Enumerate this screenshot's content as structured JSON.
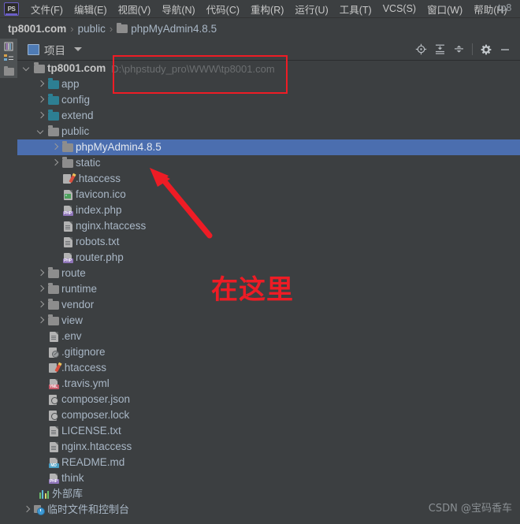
{
  "window": {
    "title_truncated": "tp8",
    "app_icon": "ps-icon"
  },
  "menubar": {
    "items": [
      {
        "label": "文件(F)",
        "name": "menu-file"
      },
      {
        "label": "编辑(E)",
        "name": "menu-edit"
      },
      {
        "label": "视图(V)",
        "name": "menu-view"
      },
      {
        "label": "导航(N)",
        "name": "menu-navigate"
      },
      {
        "label": "代码(C)",
        "name": "menu-code"
      },
      {
        "label": "重构(R)",
        "name": "menu-refactor"
      },
      {
        "label": "运行(U)",
        "name": "menu-run"
      },
      {
        "label": "工具(T)",
        "name": "menu-tools"
      },
      {
        "label": "VCS(S)",
        "name": "menu-vcs"
      },
      {
        "label": "窗口(W)",
        "name": "menu-window"
      },
      {
        "label": "帮助(H)",
        "name": "menu-help"
      }
    ]
  },
  "breadcrumb": {
    "items": [
      "tp8001.com",
      "public",
      "phpMyAdmin4.8.5"
    ],
    "separator": "›"
  },
  "toolwindow": {
    "title": "项目",
    "actions": [
      {
        "name": "locate-file-icon",
        "title": "定位"
      },
      {
        "name": "expand-all-icon",
        "title": "全部展开"
      },
      {
        "name": "collapse-all-icon",
        "title": "全部折叠"
      },
      {
        "name": "settings-gear-icon",
        "title": "设置"
      },
      {
        "name": "hide-minimize-icon",
        "title": "隐藏"
      }
    ]
  },
  "stripe": {
    "tabs": [
      {
        "name": "stripe-tab-project",
        "label": "项目"
      }
    ]
  },
  "tree": {
    "root_hint": "D:\\phpstudy_pro\\WWW\\tp8001.com",
    "rows": [
      {
        "label": "tp8001.com",
        "depth": 0,
        "toggle": "expanded",
        "icon": "folder",
        "style": "bold",
        "hint": true,
        "selected": false
      },
      {
        "label": "app",
        "depth": 1,
        "toggle": "collapsed",
        "icon": "folder-src",
        "selected": false
      },
      {
        "label": "config",
        "depth": 1,
        "toggle": "collapsed",
        "icon": "folder-src",
        "selected": false
      },
      {
        "label": "extend",
        "depth": 1,
        "toggle": "collapsed",
        "icon": "folder-src",
        "selected": false
      },
      {
        "label": "public",
        "depth": 1,
        "toggle": "expanded",
        "icon": "folder",
        "selected": false
      },
      {
        "label": "phpMyAdmin4.8.5",
        "depth": 2,
        "toggle": "collapsed",
        "icon": "folder",
        "selected": true
      },
      {
        "label": "static",
        "depth": 2,
        "toggle": "collapsed",
        "icon": "folder",
        "selected": false
      },
      {
        "label": ".htaccess",
        "depth": 2,
        "toggle": "none",
        "icon": "pencil",
        "selected": false
      },
      {
        "label": "favicon.ico",
        "depth": 2,
        "toggle": "none",
        "icon": "image",
        "selected": false
      },
      {
        "label": "index.php",
        "depth": 2,
        "toggle": "none",
        "icon": "php",
        "selected": false
      },
      {
        "label": "nginx.htaccess",
        "depth": 2,
        "toggle": "none",
        "icon": "doc",
        "selected": false
      },
      {
        "label": "robots.txt",
        "depth": 2,
        "toggle": "none",
        "icon": "doc",
        "selected": false
      },
      {
        "label": "router.php",
        "depth": 2,
        "toggle": "none",
        "icon": "php",
        "selected": false
      },
      {
        "label": "route",
        "depth": 1,
        "toggle": "collapsed",
        "icon": "folder",
        "selected": false
      },
      {
        "label": "runtime",
        "depth": 1,
        "toggle": "collapsed",
        "icon": "folder",
        "selected": false
      },
      {
        "label": "vendor",
        "depth": 1,
        "toggle": "collapsed",
        "icon": "folder",
        "selected": false
      },
      {
        "label": "view",
        "depth": 1,
        "toggle": "collapsed",
        "icon": "folder",
        "selected": false
      },
      {
        "label": ".env",
        "depth": 1,
        "toggle": "none",
        "icon": "doc",
        "selected": false
      },
      {
        "label": ".gitignore",
        "depth": 1,
        "toggle": "none",
        "icon": "git",
        "selected": false
      },
      {
        "label": ".htaccess",
        "depth": 1,
        "toggle": "none",
        "icon": "pencil",
        "selected": false
      },
      {
        "label": ".travis.yml",
        "depth": 1,
        "toggle": "none",
        "icon": "yml",
        "selected": false
      },
      {
        "label": "composer.json",
        "depth": 1,
        "toggle": "none",
        "icon": "json",
        "selected": false
      },
      {
        "label": "composer.lock",
        "depth": 1,
        "toggle": "none",
        "icon": "json",
        "selected": false
      },
      {
        "label": "LICENSE.txt",
        "depth": 1,
        "toggle": "none",
        "icon": "doc",
        "selected": false
      },
      {
        "label": "nginx.htaccess",
        "depth": 1,
        "toggle": "none",
        "icon": "doc",
        "selected": false
      },
      {
        "label": "README.md",
        "depth": 1,
        "toggle": "none",
        "icon": "md",
        "selected": false
      },
      {
        "label": "think",
        "depth": 1,
        "toggle": "none",
        "icon": "php",
        "selected": false
      },
      {
        "label": "外部库",
        "depth": 0,
        "toggle": "none",
        "icon": "lib",
        "style": "cn",
        "indent_icon": true,
        "selected": false
      },
      {
        "label": "临时文件和控制台",
        "depth": 0,
        "toggle": "collapsed",
        "icon": "scratch",
        "style": "cn",
        "selected": false
      }
    ]
  },
  "annotations": {
    "path_box": {
      "name": "root-path-highlight-box"
    },
    "arrow": {
      "name": "red-pointer-arrow"
    },
    "text": "在这里",
    "color": "#ee1c25"
  },
  "watermark": {
    "text": "CSDN @宝码香车"
  },
  "colors": {
    "background": "#3c3f41",
    "selection": "#4b6eaf",
    "text": "#a9b7c6",
    "accent_red": "#ee1c25",
    "source_folder": "#2d7f93"
  }
}
